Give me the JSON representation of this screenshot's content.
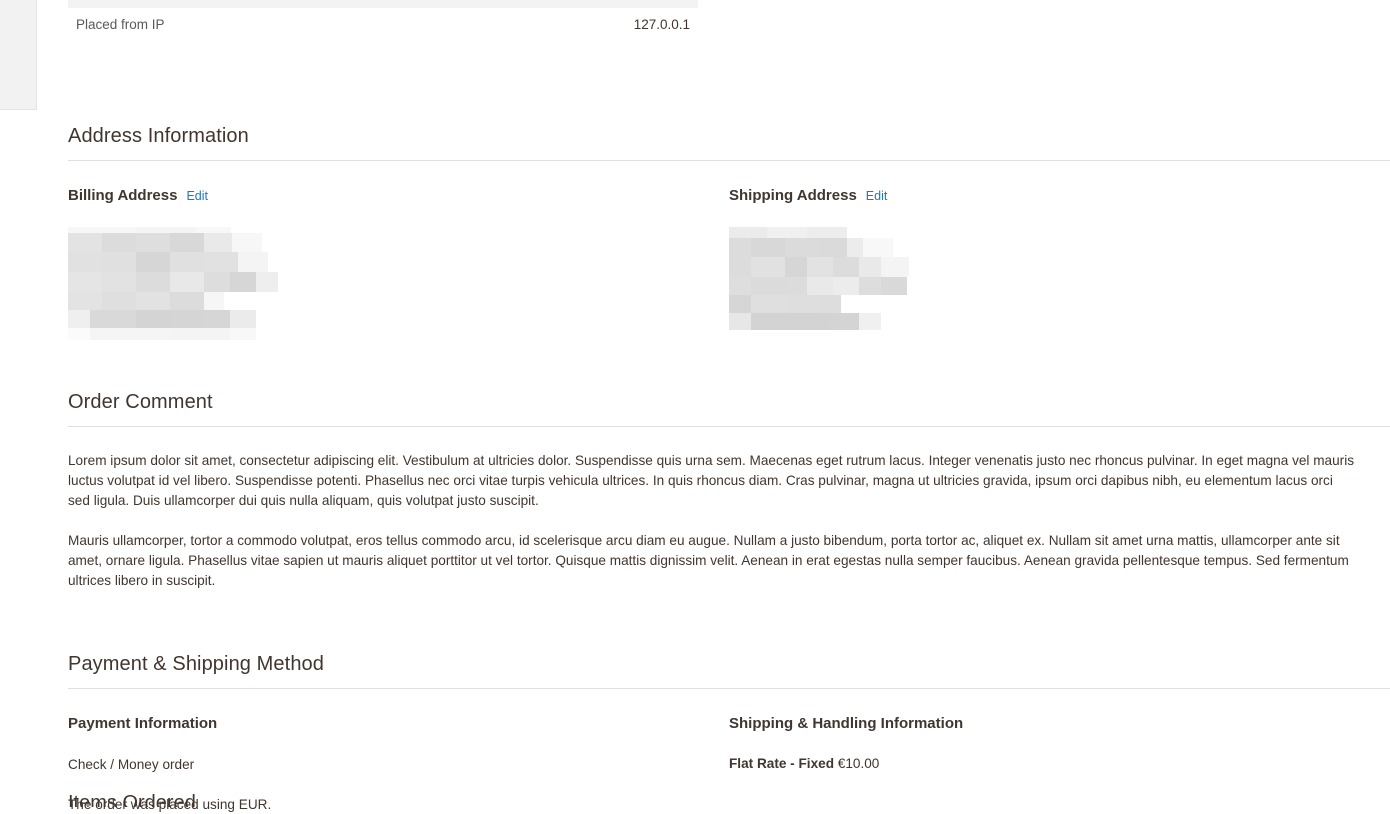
{
  "order_info": {
    "rows": [
      {
        "label": "Placed from IP",
        "value": "127.0.0.1"
      }
    ]
  },
  "address_information": {
    "title": "Address Information",
    "billing": {
      "title": "Billing Address",
      "edit_label": "Edit",
      "redacted": true
    },
    "shipping": {
      "title": "Shipping Address",
      "edit_label": "Edit",
      "redacted": true
    }
  },
  "order_comment": {
    "title": "Order Comment",
    "paragraphs": [
      "Lorem ipsum dolor sit amet, consectetur adipiscing elit. Vestibulum at ultricies dolor. Suspendisse quis urna sem. Maecenas eget rutrum lacus. Integer venenatis justo nec rhoncus pulvinar. In eget magna vel mauris luctus volutpat id vel libero. Suspendisse potenti. Phasellus nec orci vitae turpis vehicula ultrices. In quis rhoncus diam. Cras pulvinar, magna ut ultricies gravida, ipsum orci dapibus nibh, eu elementum lacus orci sed ligula. Duis ullamcorper dui quis nulla aliquam, quis volutpat justo suscipit.",
      "Mauris ullamcorper, tortor a commodo volutpat, eros tellus commodo arcu, id scelerisque arcu diam eu augue. Nullam a justo bibendum, porta tortor ac, aliquet ex. Nullam sit amet urna mattis, ullamcorper ante sit amet, ornare ligula. Phasellus vitae sapien ut mauris aliquet porttitor ut vel tortor. Quisque mattis dignissim velit. Aenean in erat egestas nulla semper faucibus. Aenean gravida pellentesque tempus. Sed fermentum ultrices libero in suscipit."
    ]
  },
  "payment_shipping": {
    "title": "Payment & Shipping Method",
    "payment": {
      "title": "Payment Information",
      "method": "Check / Money order",
      "currency_note": "The order was placed using EUR."
    },
    "shipping": {
      "title": "Shipping & Handling Information",
      "method": "Flat Rate - Fixed",
      "amount": "€10.00"
    }
  },
  "items_ordered": {
    "title": "Items Ordered"
  },
  "colors": {
    "link": "#1979c3",
    "text": "#41362f",
    "muted": "#5a5a5a",
    "divider": "#e0e0e0",
    "band": "#f3f3f3",
    "panel": "#f2f2f2"
  }
}
